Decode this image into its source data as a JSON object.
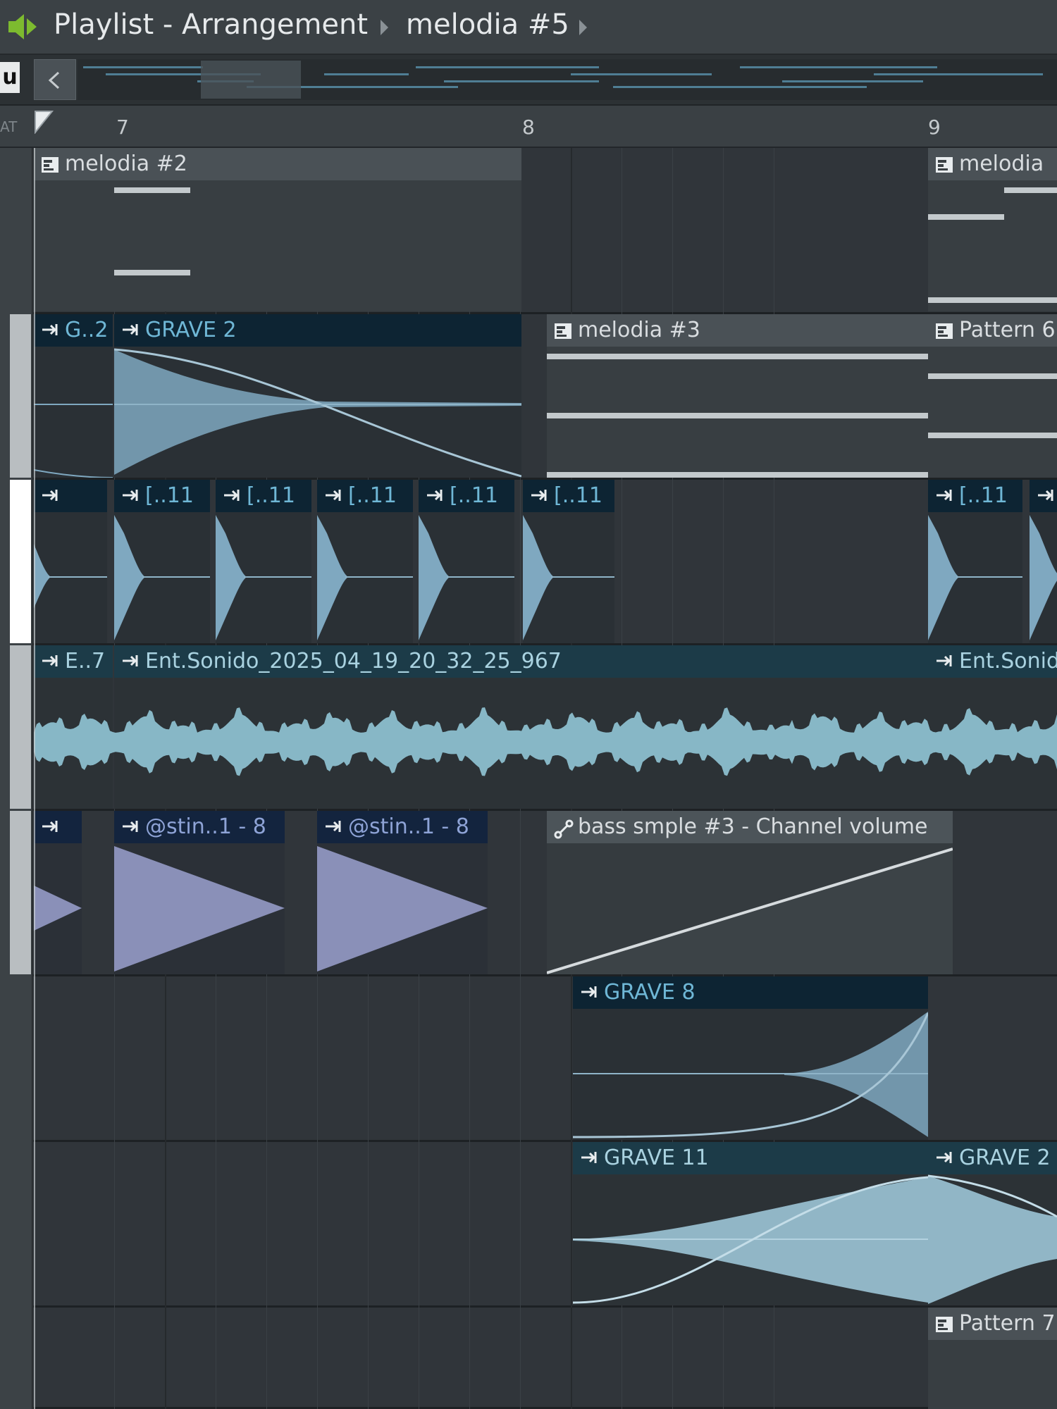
{
  "titlebar": {
    "title": "Playlist - Arrangement",
    "current_pattern": "melodia #5"
  },
  "ruler": {
    "bar_labels": [
      "7",
      "8",
      "9"
    ],
    "corner_label": "AT"
  },
  "overview": {
    "tag_letter": "u"
  },
  "colors": {
    "pattern_header": "#4a5156",
    "audio_header_dark": "#0d2433",
    "audio_header_teal": "#1c3b48",
    "audio_header_navy": "#13243e",
    "waveform_blue": "#7fa8c0",
    "waveform_violet": "#8a90b8"
  },
  "clips": {
    "melodia2": "melodia #2",
    "melodia_right": "melodia",
    "g2_short": "G..2",
    "grave2": "GRAVE 2",
    "melodia3": "melodia #3",
    "pattern6": "Pattern 6",
    "slice_label": "[..11",
    "ent_short": "E..7",
    "ent_full": "Ent.Sonido_2025_04_19_20_32_25_967",
    "ent_right": "Ent.Sonido",
    "stin": "@stin..1 - 8",
    "bass_auto": "bass smple #3 - Channel volume",
    "grave8": "GRAVE 8",
    "grave11": "GRAVE 11",
    "grave2_right": "GRAVE 2",
    "pattern7": "Pattern 7"
  }
}
